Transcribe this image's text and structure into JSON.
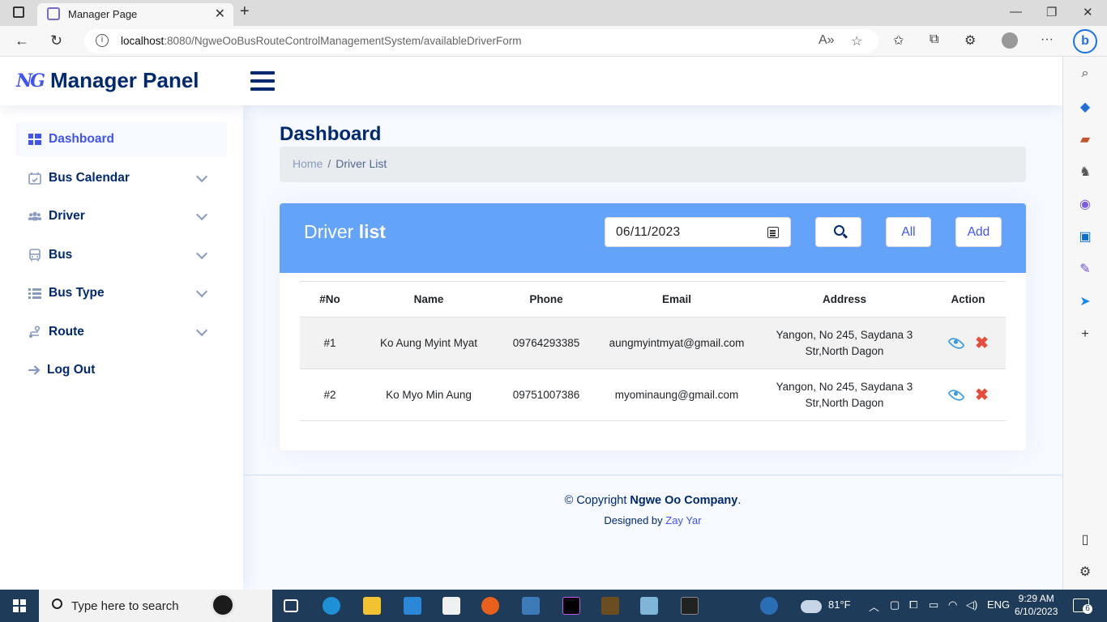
{
  "browser": {
    "tab_title": "Manager Page",
    "url_host": "localhost",
    "url_rest": ":8080/NgweOoBusRouteControlManagementSystem/availableDriverForm"
  },
  "header": {
    "logo_mark": "NG",
    "title": "Manager Panel"
  },
  "sidebar": {
    "items": [
      {
        "label": "Dashboard",
        "icon": "grid-icon",
        "active": true,
        "expandable": false
      },
      {
        "label": "Bus Calendar",
        "icon": "calendar-icon",
        "active": false,
        "expandable": true
      },
      {
        "label": "Driver",
        "icon": "people-icon",
        "active": false,
        "expandable": true
      },
      {
        "label": "Bus",
        "icon": "bus-icon",
        "active": false,
        "expandable": true
      },
      {
        "label": "Bus Type",
        "icon": "list-icon",
        "active": false,
        "expandable": true
      },
      {
        "label": "Route",
        "icon": "route-icon",
        "active": false,
        "expandable": true
      },
      {
        "label": "Log Out",
        "icon": "arrow-right-icon",
        "active": false,
        "expandable": false
      }
    ]
  },
  "main": {
    "page_title": "Dashboard",
    "breadcrumb": {
      "home": "Home",
      "separator": "/",
      "current": "Driver List"
    },
    "card": {
      "title_regular": "Driver",
      "title_bold": "list",
      "date_value": "06/11/2023",
      "all_label": "All",
      "add_label": "Add"
    },
    "table": {
      "columns": [
        "#No",
        "Name",
        "Phone",
        "Email",
        "Address",
        "Action"
      ],
      "rows": [
        {
          "no": "#1",
          "name": "Ko Aung Myint Myat",
          "phone": "09764293385",
          "email": "aungmyintmyat@gmail.com",
          "address": "Yangon, No 245, Saydana 3 Str,North Dagon"
        },
        {
          "no": "#2",
          "name": "Ko Myo Min Aung",
          "phone": "09751007386",
          "email": "myominaung@gmail.com",
          "address": "Yangon, No 245, Saydana 3 Str,North Dagon"
        }
      ]
    }
  },
  "footer": {
    "copyright_prefix": "© Copyright",
    "company": "Ngwe Oo Company",
    "copyright_suffix": ".",
    "designed_prefix": "Designed by",
    "designer": "Zay Yar"
  },
  "taskbar": {
    "search_placeholder": "Type here to search",
    "weather": "81°F",
    "language": "ENG",
    "time": "9:29 AM",
    "date": "6/10/2023",
    "notification_count": "6"
  },
  "colors": {
    "brand": "#4154f1",
    "navy": "#012970",
    "card_header": "#63a4fa",
    "delete": "#e74c3c",
    "view": "#3b9ae1"
  }
}
